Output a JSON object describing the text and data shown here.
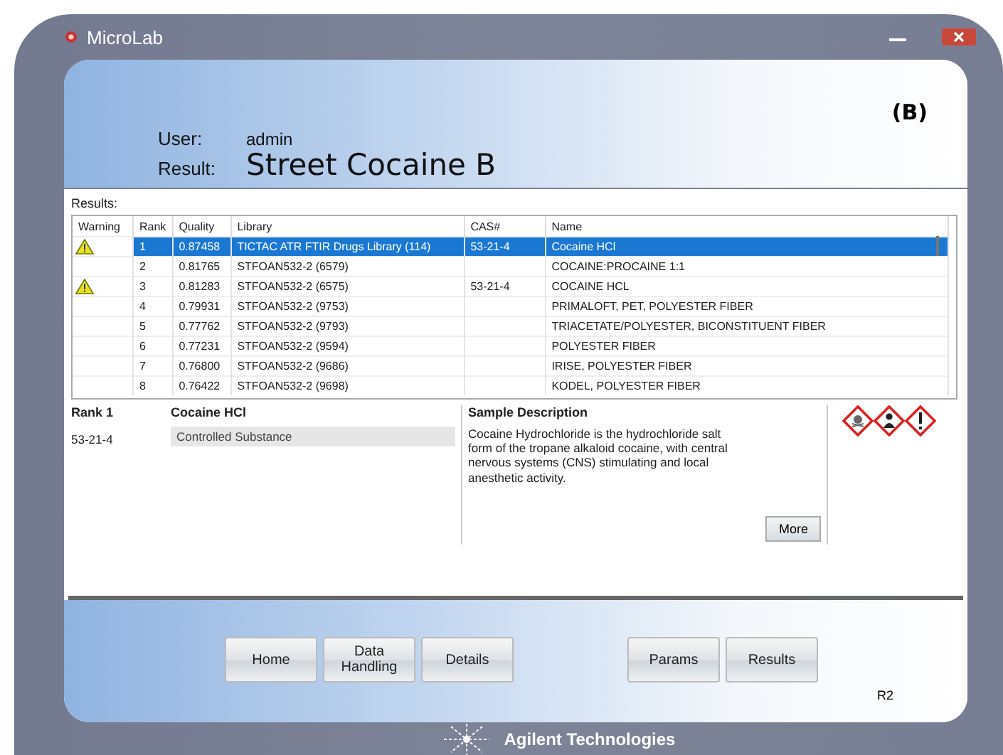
{
  "window": {
    "title": "MicroLab"
  },
  "header": {
    "user_label": "User:",
    "user": "admin",
    "result_label": "Result:",
    "result": "Street Cocaine B",
    "tag": "(B)"
  },
  "results_label": "Results:",
  "table": {
    "columns": [
      "Warning",
      "Rank",
      "Quality",
      "Library",
      "CAS#",
      "Name"
    ],
    "rows": [
      {
        "warning": true,
        "selected": true,
        "rank": "1",
        "quality": "0.87458",
        "library": "TICTAC ATR FTIR Drugs Library (114)",
        "cas": "53-21-4",
        "name": "Cocaine HCl"
      },
      {
        "warning": false,
        "selected": false,
        "rank": "2",
        "quality": "0.81765",
        "library": "STFOAN532-2 (6579)",
        "cas": "",
        "name": "COCAINE:PROCAINE 1:1"
      },
      {
        "warning": true,
        "selected": false,
        "rank": "3",
        "quality": "0.81283",
        "library": "STFOAN532-2 (6575)",
        "cas": "53-21-4",
        "name": "COCAINE HCL"
      },
      {
        "warning": false,
        "selected": false,
        "rank": "4",
        "quality": "0.79931",
        "library": "STFOAN532-2 (9753)",
        "cas": "",
        "name": "PRIMALOFT, PET, POLYESTER FIBER"
      },
      {
        "warning": false,
        "selected": false,
        "rank": "5",
        "quality": "0.77762",
        "library": "STFOAN532-2 (9793)",
        "cas": "",
        "name": "TRIACETATE/POLYESTER, BICONSTITUENT FIBER"
      },
      {
        "warning": false,
        "selected": false,
        "rank": "6",
        "quality": "0.77231",
        "library": "STFOAN532-2 (9594)",
        "cas": "",
        "name": "POLYESTER FIBER"
      },
      {
        "warning": false,
        "selected": false,
        "rank": "7",
        "quality": "0.76800",
        "library": "STFOAN532-2 (9686)",
        "cas": "",
        "name": "IRISE, POLYESTER FIBER"
      },
      {
        "warning": false,
        "selected": false,
        "rank": "8",
        "quality": "0.76422",
        "library": "STFOAN532-2 (9698)",
        "cas": "",
        "name": "KODEL, POLYESTER FIBER"
      }
    ]
  },
  "detail": {
    "rank": "Rank 1",
    "cas": "53-21-4",
    "name": "Cocaine HCl",
    "category": "Controlled Substance",
    "description_title": "Sample Description",
    "description": "Cocaine Hydrochloride is the hydrochloride salt form of the tropane alkaloid cocaine, with central nervous systems (CNS) stimulating and local anesthetic activity.",
    "more_button": "More"
  },
  "buttons_left": [
    "Home",
    "Data Handling",
    "Details"
  ],
  "buttons_right": [
    "Params",
    "Results"
  ],
  "revision": "R2",
  "brand": "Agilent Technologies"
}
